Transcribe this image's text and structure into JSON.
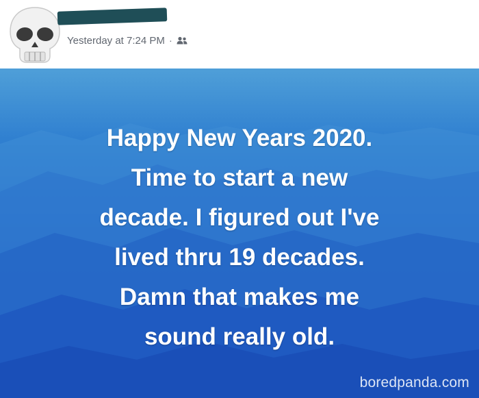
{
  "post": {
    "timestamp": "Yesterday at 7:24 PM",
    "separator": "·",
    "audience_icon": "friends-icon",
    "avatar_icon": "skull-icon",
    "status_text": "Happy New Years 2020.\nTime to start a new\ndecade.  I figured out I've\nlived thru 19 decades.\nDamn that makes me\nsound really old.",
    "background_color": "#1e5fc6"
  },
  "watermark": "boredpanda.com"
}
